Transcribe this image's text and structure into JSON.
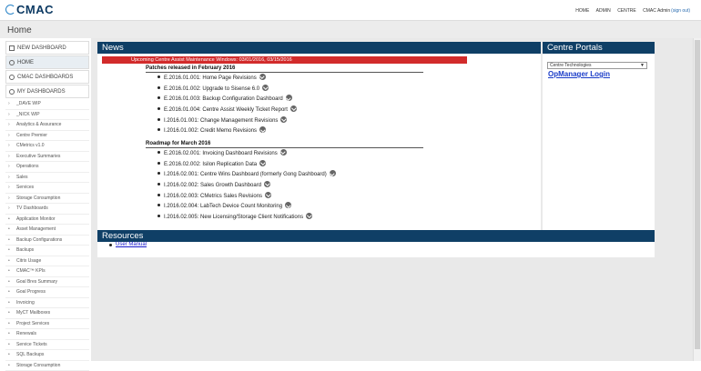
{
  "header": {
    "logo_text": "CMAC",
    "nav": [
      "HOME",
      "ADMIN",
      "CENTRE"
    ],
    "user": "CMAC Admin",
    "signout": "(sign out)"
  },
  "page_title": "Home",
  "sidebar": {
    "new_dashboard": "NEW DASHBOARD",
    "items": [
      {
        "label": "HOME",
        "type": "big",
        "icon": "home-icon"
      },
      {
        "label": "CMAC DASHBOARDS",
        "type": "big",
        "icon": "plus-circle-icon"
      },
      {
        "label": "MY DASHBOARDS",
        "type": "big",
        "icon": "globe-icon"
      },
      {
        "label": "_DAVE WIP",
        "type": "folder"
      },
      {
        "label": "_NICK WIP",
        "type": "folder"
      },
      {
        "label": "Analytics & Assurance",
        "type": "folder"
      },
      {
        "label": "Centre Premier",
        "type": "folder"
      },
      {
        "label": "CMetrics v1.0",
        "type": "folder"
      },
      {
        "label": "Executive Summaries",
        "type": "folder"
      },
      {
        "label": "Operations",
        "type": "folder"
      },
      {
        "label": "Sales",
        "type": "folder"
      },
      {
        "label": "Services",
        "type": "folder"
      },
      {
        "label": "Storage Consumption",
        "type": "folder"
      },
      {
        "label": "TV Dashboards",
        "type": "folder"
      },
      {
        "label": "Application Monitor",
        "type": "leaf"
      },
      {
        "label": "Asset Management",
        "type": "leaf"
      },
      {
        "label": "Backup Configurations",
        "type": "leaf"
      },
      {
        "label": "Backups",
        "type": "leaf"
      },
      {
        "label": "Citrix Usage",
        "type": "leaf"
      },
      {
        "label": "CMAC™ KPIs",
        "type": "leaf"
      },
      {
        "label": "Goal Bres Summary",
        "type": "leaf"
      },
      {
        "label": "Goal Progress",
        "type": "leaf"
      },
      {
        "label": "Invoicing",
        "type": "leaf"
      },
      {
        "label": "MyCT Mailboxes",
        "type": "leaf"
      },
      {
        "label": "Project Services",
        "type": "leaf"
      },
      {
        "label": "Renewals",
        "type": "leaf"
      },
      {
        "label": "Service Tickets",
        "type": "leaf"
      },
      {
        "label": "SQL Backups",
        "type": "leaf"
      },
      {
        "label": "Storage Consumption",
        "type": "leaf"
      }
    ]
  },
  "news": {
    "title": "News",
    "alert": "Upcoming Centre Assist Maintenance Windows: 03/01/2016, 03/15/2016",
    "patches_heading": "Patches released in February 2016",
    "patches": [
      "E.2016.01.001: Home Page Revisions",
      "E.2016.01.002: Upgrade to Sisense 6.0",
      "E.2016.01.003: Backup Configuration Dashboard",
      "E.2016.01.004: Centre Assist Weekly Ticket Report",
      "I.2016.01.001: Change Management Revisions",
      "I.2016.01.002: Credit Memo Revisions"
    ],
    "roadmap_heading": "Roadmap for March 2016",
    "roadmap": [
      "E.2016.02.001: Invoicing Dashboard Revisions",
      "E.2016.02.002: Isilon Replication Data",
      "I.2016.02.001: Centre Wins Dashboard (formerly Gong Dashboard)",
      "I.2016.02.002: Sales Growth Dashboard",
      "I.2016.02.003: CMetrics Sales Revisions",
      "I.2016.02.004: LabTech Device Count Monitoring",
      "I.2016.02.005: New Licensing/Storage Client Notifications"
    ]
  },
  "portals": {
    "title": "Centre Portals",
    "select_value": "Centre Technologies",
    "link": "OpManager Login"
  },
  "resources": {
    "title": "Resources",
    "link": "User Manual"
  }
}
